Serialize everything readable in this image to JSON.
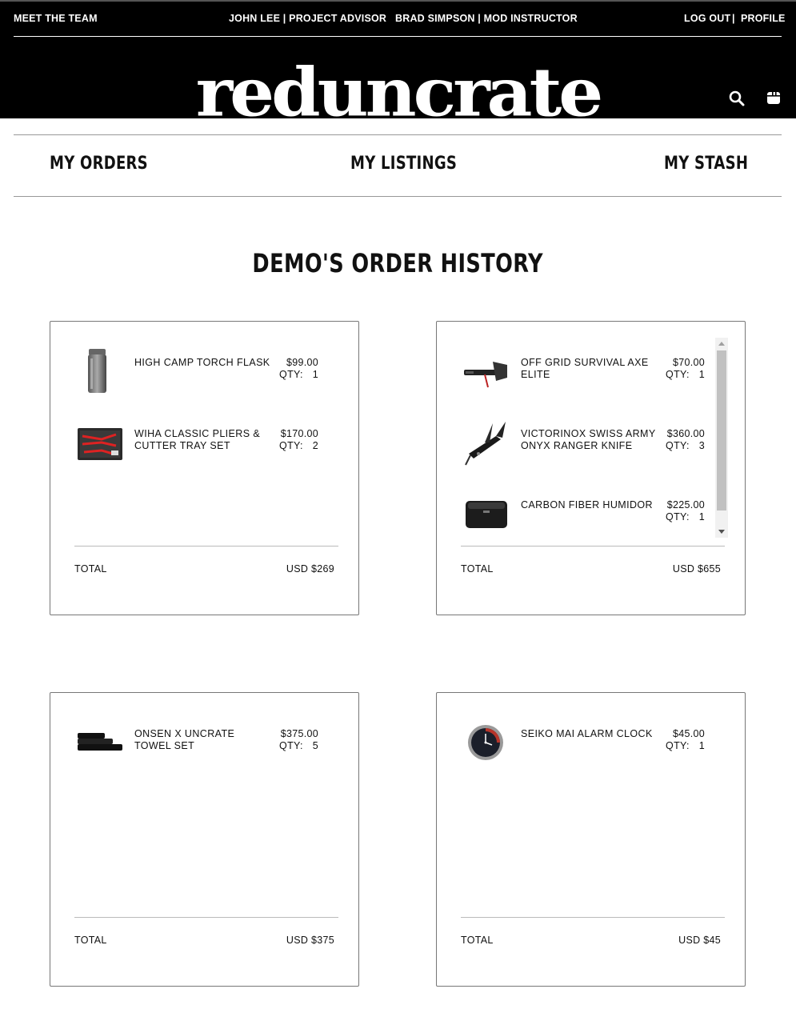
{
  "topnav": {
    "meet_team": "MEET THE TEAM",
    "advisor": "JOHN LEE | PROJECT ADVISOR",
    "instructor": "BRAD SIMPSON | MOD INSTRUCTOR",
    "logout": "LOG OUT",
    "separator": "|",
    "profile": "PROFILE"
  },
  "brand": {
    "logo_text": "reduncrate"
  },
  "icons": {
    "search": "search-icon",
    "crate": "crate-icon"
  },
  "subnav": {
    "orders": "MY ORDERS",
    "listings": "MY LISTINGS",
    "stash": "MY STASH"
  },
  "page": {
    "title": "DEMO'S ORDER HISTORY"
  },
  "orders": [
    {
      "items": [
        {
          "name": "HIGH CAMP TORCH FLASK",
          "price": "$99.00",
          "qty_label": "QTY:",
          "qty": "1",
          "icon": "flask-icon"
        },
        {
          "name": "WIHA CLASSIC PLIERS & CUTTER TRAY SET",
          "price": "$170.00",
          "qty_label": "QTY:",
          "qty": "2",
          "icon": "pliers-tray-icon"
        }
      ],
      "total_label": "TOTAL",
      "total": "USD $269"
    },
    {
      "items": [
        {
          "name": "OFF GRID SURVIVAL AXE ELITE",
          "price": "$70.00",
          "qty_label": "QTY:",
          "qty": "1",
          "icon": "axe-icon"
        },
        {
          "name": "VICTORINOX SWISS ARMY ONYX RANGER KNIFE",
          "price": "$360.00",
          "qty_label": "QTY:",
          "qty": "3",
          "icon": "knife-icon"
        },
        {
          "name": "CARBON FIBER HUMIDOR",
          "price": "$225.00",
          "qty_label": "QTY:",
          "qty": "1",
          "icon": "humidor-icon"
        }
      ],
      "total_label": "TOTAL",
      "total": "USD $655"
    },
    {
      "items": [
        {
          "name": "ONSEN X UNCRATE TOWEL SET",
          "price": "$375.00",
          "qty_label": "QTY:",
          "qty": "5",
          "icon": "towel-icon"
        }
      ],
      "total_label": "TOTAL",
      "total": "USD $375"
    },
    {
      "items": [
        {
          "name": "SEIKO MAI ALARM CLOCK",
          "price": "$45.00",
          "qty_label": "QTY:",
          "qty": "1",
          "icon": "clock-icon"
        }
      ],
      "total_label": "TOTAL",
      "total": "USD $45"
    }
  ]
}
